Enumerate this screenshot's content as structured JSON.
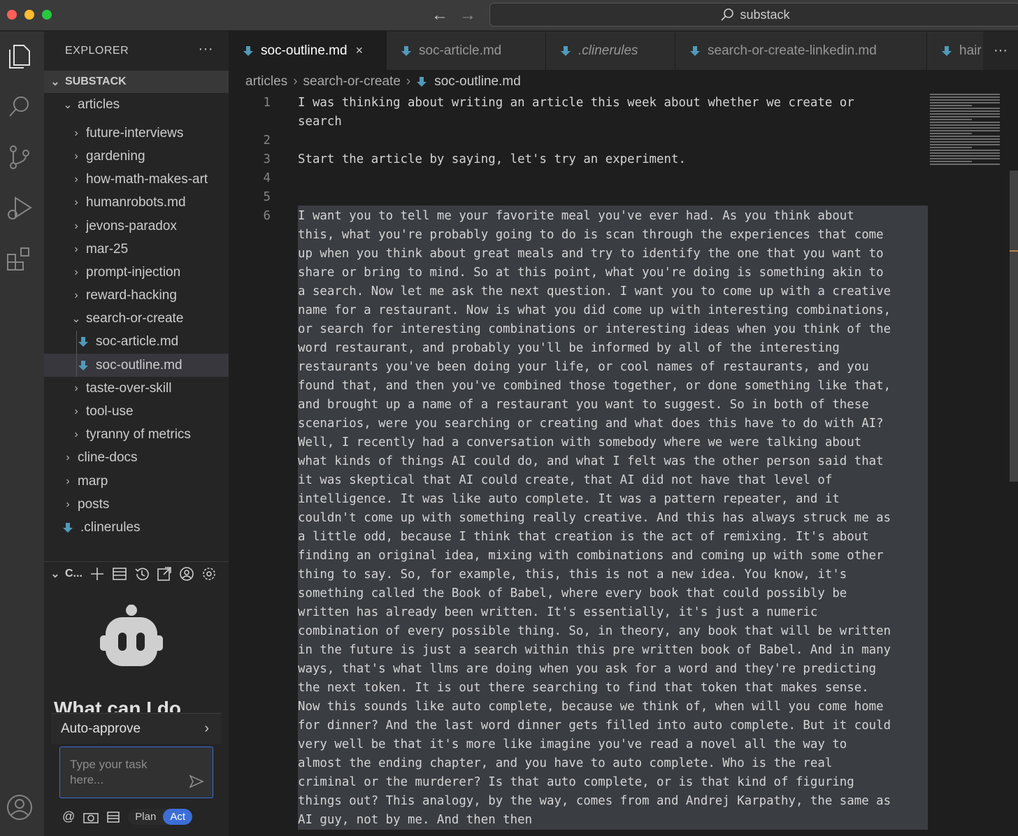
{
  "window": {
    "search_label": "substack"
  },
  "explorer": {
    "title": "EXPLORER",
    "more": "···",
    "root": "SUBSTACK",
    "folders": {
      "articles": "articles",
      "children": [
        "future-interviews",
        "gardening",
        "how-math-makes-art",
        "humanrobots.md",
        "jevons-paradox",
        "mar-25",
        "prompt-injection",
        "reward-hacking"
      ],
      "open_folder": "search-or-create",
      "open_files": [
        "soc-article.md",
        "soc-outline.md"
      ],
      "after": [
        "taste-over-skill",
        "tool-use",
        "tyranny of metrics"
      ],
      "top_level": [
        "cline-docs",
        "marp",
        "posts"
      ],
      "top_file": ".clinerules"
    }
  },
  "cline": {
    "title": "C...",
    "heading": "What can I do",
    "auto_approve": "Auto-approve",
    "input_placeholder": "Type your task here...",
    "mode_plan": "Plan",
    "mode_act": "Act",
    "footer_at": "@"
  },
  "tabs": [
    {
      "label": "soc-outline.md",
      "active": true,
      "close": "×"
    },
    {
      "label": "soc-article.md",
      "active": false
    },
    {
      "label": ".clinerules",
      "active": false
    },
    {
      "label": "search-or-create-linkedin.md",
      "active": false
    },
    {
      "label": "hair",
      "active": false
    }
  ],
  "breadcrumb": [
    "articles",
    "search-or-create",
    "soc-outline.md"
  ],
  "editor": {
    "line_numbers": [
      "1",
      "2",
      "3",
      "4",
      "5",
      "6"
    ],
    "lines": [
      "I was thinking about writing an article this week about whether we create or",
      "search",
      "",
      "Start the article by saying, let's try an experiment.",
      "",
      "",
      "",
      "I want you to tell me your favorite meal you've ever had. As you think about",
      "this, what you're probably going to do is scan through the experiences that come",
      "up when you think about great meals and try to identify the one that you want to",
      "share or bring to mind. So at this point, what you're doing is something akin to",
      "a search. Now let me ask the next question. I want you to come up with a creative",
      "name for a restaurant. Now is what you did come up with interesting combinations,",
      "or search for interesting combinations or interesting ideas when you think of the",
      "word restaurant, and probably you'll be informed by all of the interesting",
      "restaurants you've been doing your life, or cool names of restaurants, and you",
      "found that, and then you've combined those together, or done something like that,",
      "and brought up a name of a restaurant you want to suggest. So in both of these",
      "scenarios, were you searching or creating and what does this have to do with AI?",
      "Well, I recently had a conversation with somebody where we were talking about",
      "what kinds of things AI could do, and what I felt was the other person said that",
      "it was skeptical that AI could create, that AI did not have that level of",
      "intelligence. It was like auto complete. It was a pattern repeater, and it",
      "couldn't come up with something really creative. And this has always struck me as",
      "a little odd, because I think that creation is the act of remixing. It's about",
      "finding an original idea, mixing with combinations and coming up with some other",
      "thing to say. So, for example, this, this is not a new idea. You know, it's",
      "something called the Book of Babel, where every book that could possibly be",
      "written has already been written. It's essentially, it's just a numeric",
      "combination of every possible thing. So, in theory, any book that will be written",
      "in the future is just a search within this pre written book of Babel. And in many",
      "ways, that's what llms are doing when you ask for a word and they're predicting",
      "the next token. It is out there searching to find that token that makes sense.",
      "Now this sounds like auto complete, because we think of, when will you come home",
      "for dinner? And the last word dinner gets filled into auto complete. But it could",
      "very well be that it's more like imagine you've read a novel all the way to",
      "almost the ending chapter, and you have to auto complete. Who is the real",
      "criminal or the murderer? Is that auto complete, or is that kind of figuring",
      "things out? This analogy, by the way, comes from and Andrej Karpathy, the same as",
      "AI guy, not by me. And then then"
    ]
  },
  "colors": {
    "accent": "#3c6ed6",
    "md_icon": "#519aba"
  }
}
